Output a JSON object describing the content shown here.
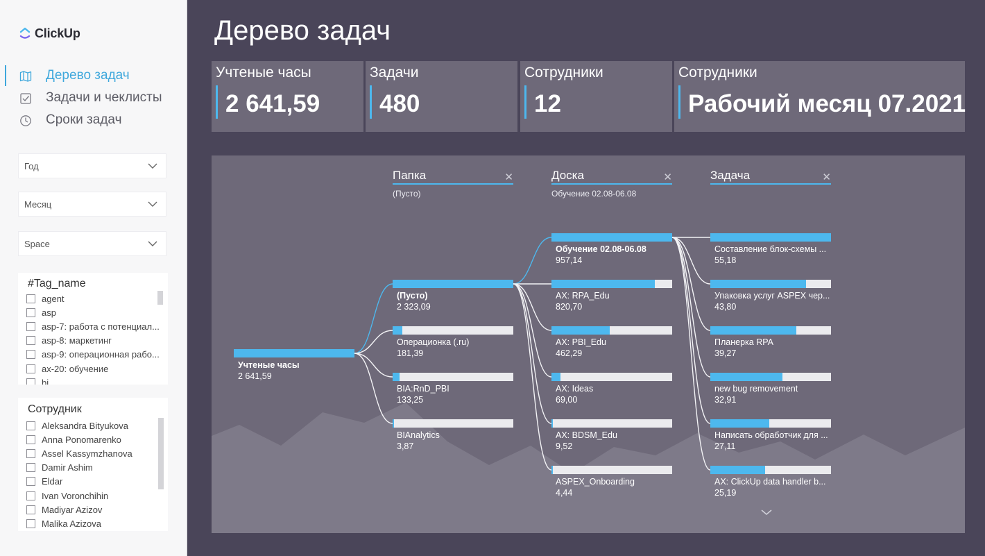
{
  "app": {
    "logo_text": "ClickUp"
  },
  "nav": [
    {
      "label": "Дерево задач",
      "icon": "map-icon",
      "active": true
    },
    {
      "label": "Задачи и чеклисты",
      "icon": "checkbox-icon",
      "active": false
    },
    {
      "label": "Сроки задач",
      "icon": "clock-icon",
      "active": false
    }
  ],
  "filters": {
    "year": "Год",
    "month": "Месяц",
    "space": "Space"
  },
  "tag_list": {
    "title": "#Tag_name",
    "items": [
      "agent",
      "asp",
      "asp-7: работа с потенциал...",
      "asp-8: маркетинг",
      "asp-9: операционная рабо...",
      "ax-20: обучение",
      "bi"
    ]
  },
  "employee_list": {
    "title": "Сотрудник",
    "items": [
      "Aleksandra Bityukova",
      "Anna Ponomarenko",
      "Assel Kassymzhanova",
      "Damir Ashim",
      "Eldar",
      "Ivan Voronchihin",
      "Madiyar Azizov",
      "Malika Azizova"
    ]
  },
  "page": {
    "title": "Дерево задач"
  },
  "cards": [
    {
      "title": "Учтеные часы",
      "value": "2 641,59"
    },
    {
      "title": "Задачи",
      "value": "480"
    },
    {
      "title": "Сотрудники",
      "value": "12"
    },
    {
      "title": "Сотрудники",
      "value": "Рабочий месяц 07.2021"
    }
  ],
  "tree": {
    "levels": [
      {
        "title": "Папка",
        "subtitle": "(Пусто)",
        "close_icon": "close-icon"
      },
      {
        "title": "Доска",
        "subtitle": "Обучение 02.08-06.08",
        "close_icon": "close-icon"
      },
      {
        "title": "Задача",
        "subtitle": "",
        "close_icon": "close-icon"
      }
    ],
    "root": {
      "label": "Учтеные часы",
      "value": "2 641,59",
      "fill": 1.0
    },
    "folders": [
      {
        "label": "(Пусто)",
        "value": "2 323,09",
        "fill": 1.0,
        "selected": true
      },
      {
        "label": "Операционка (.ru)",
        "value": "181,39",
        "fill": 0.078
      },
      {
        "label": "BIA:RnD_PBI",
        "value": "133,25",
        "fill": 0.057
      },
      {
        "label": "BIAnalytics",
        "value": "3,87",
        "fill": 0.002
      }
    ],
    "boards": [
      {
        "label": "Обучение 02.08-06.08",
        "value": "957,14",
        "fill": 1.0,
        "selected": true
      },
      {
        "label": "AX: RPA_Edu",
        "value": "820,70",
        "fill": 0.857
      },
      {
        "label": "AX: PBI_Edu",
        "value": "462,29",
        "fill": 0.483
      },
      {
        "label": "AX: Ideas",
        "value": "69,00",
        "fill": 0.072
      },
      {
        "label": "AX: BDSM_Edu",
        "value": "9,52",
        "fill": 0.01
      },
      {
        "label": "ASPEX_Onboarding",
        "value": "4,44",
        "fill": 0.005
      }
    ],
    "tasks": [
      {
        "label": "Составление блок-схемы ...",
        "value": "55,18",
        "fill": 1.0
      },
      {
        "label": "Упаковка услуг ASPEX чер...",
        "value": "43,80",
        "fill": 0.794
      },
      {
        "label": "Планерка RPA",
        "value": "39,27",
        "fill": 0.712
      },
      {
        "label": "new bug removement",
        "value": "32,91",
        "fill": 0.596
      },
      {
        "label": "Написать обработчик для ...",
        "value": "27,11",
        "fill": 0.491
      },
      {
        "label": "AX: ClickUp data handler b...",
        "value": "25,19",
        "fill": 0.456
      }
    ]
  },
  "colors": {
    "accent": "#4db8ee",
    "background": "#4a4559",
    "card": "#6e6979",
    "sidebar": "#f7f7f8"
  }
}
